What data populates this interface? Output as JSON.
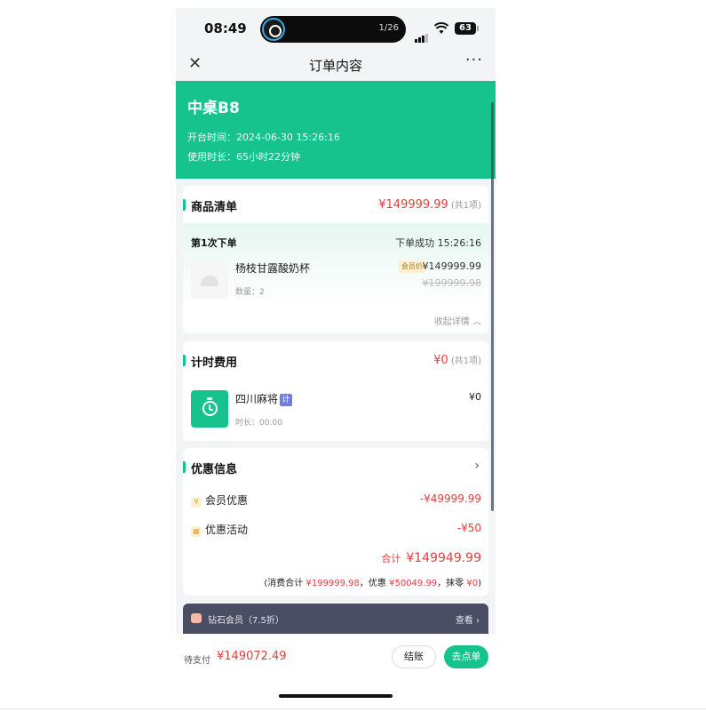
{
  "status_bar": {
    "time": "08:49",
    "island_counter": "1/26",
    "battery": "63"
  },
  "nav": {
    "title": "订单内容",
    "close_icon": "close-icon",
    "more_icon": "more-icon"
  },
  "table": {
    "name": "中桌B8",
    "open_time": "开台时间：2024-06-30 15:26:16",
    "duration": "使用时长：65小时22分钟"
  },
  "goods": {
    "title": "商品清单",
    "total": "¥149999.99",
    "count": "(共1项)",
    "order": {
      "label": "第1次下单",
      "status": "下单成功 15:26:16",
      "item_name": "杨枝甘露酸奶杯",
      "quantity": "数量：2",
      "member_tag": "会员价",
      "price": "¥149999.99",
      "original_price": "¥199999.98"
    },
    "collapse": "收起详情 ︿"
  },
  "timing": {
    "title": "计时费用",
    "total": "¥0",
    "count": "(共1项)",
    "item_name": "四川麻将",
    "badge": "计",
    "duration": "时长：00:00",
    "price": "¥0"
  },
  "discount": {
    "title": "优惠信息",
    "rows": [
      {
        "icon": "¥",
        "label": "会员优惠",
        "amount": "-¥49999.99"
      },
      {
        "icon": "■",
        "label": "优惠活动",
        "amount": "-¥50"
      }
    ],
    "sum_label": "合计",
    "sum_amount": "¥149949.99",
    "breakdown": {
      "p1": "(消费合计",
      "v1": "¥199999.98",
      "p2": "，优惠",
      "v2": "¥50049.99",
      "p3": "，抹零",
      "v3": "¥0",
      "p4": ")"
    }
  },
  "vip": {
    "label": "钻石会员（7.5折）",
    "view": "查看 ›"
  },
  "bottom": {
    "pay_label": "待支付",
    "pay_amount": "¥149072.49",
    "checkout": "结账",
    "order": "去点单"
  },
  "colors": {
    "brand_green": "#17c38c",
    "price_red": "#e2413d",
    "vip_bar": "#4a4e63"
  }
}
